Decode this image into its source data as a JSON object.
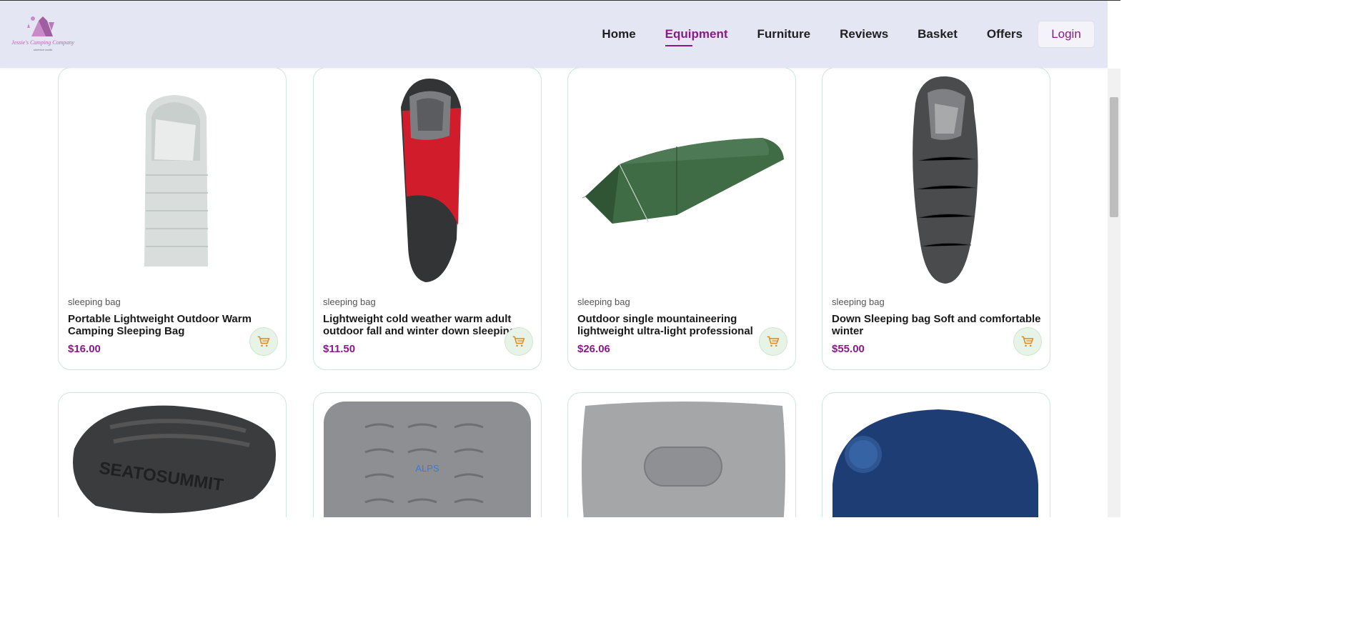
{
  "brand": {
    "logo_text": "Jessie's Camping Company",
    "logo_tagline": "adventure awaits",
    "accent_color": "#8a1a8a"
  },
  "nav": {
    "items": [
      {
        "label": "Home",
        "active": false
      },
      {
        "label": "Equipment",
        "active": true
      },
      {
        "label": "Furniture",
        "active": false
      },
      {
        "label": "Reviews",
        "active": false
      },
      {
        "label": "Basket",
        "active": false
      },
      {
        "label": "Offers",
        "active": false
      }
    ],
    "login_label": "Login"
  },
  "products": [
    {
      "category": "sleeping bag",
      "title": "Portable Lightweight Outdoor Warm Camping Sleeping Bag",
      "price": "$16.00",
      "image": "white-rectangular-sleeping-bag"
    },
    {
      "category": "sleeping bag",
      "title": "Lightweight cold weather warm adult outdoor fall and winter down sleeping bag",
      "price": "$11.50",
      "image": "red-black-mummy-sleeping-bag"
    },
    {
      "category": "sleeping bag",
      "title": "Outdoor single mountaineering lightweight ultra-light professional sleeping bag",
      "price": "$26.06",
      "image": "green-bivy-tent"
    },
    {
      "category": "sleeping bag",
      "title": "Down Sleeping bag Soft and comfortable winter",
      "price": "$55.00",
      "image": "grey-mummy-sleeping-bag"
    }
  ],
  "products_row2": [
    {
      "image": "sea-to-summit-pillow",
      "brand_text": "SEATOSUMMIT"
    },
    {
      "image": "alps-inflatable-pad",
      "brand_text": "ALPS"
    },
    {
      "image": "grey-inflatable-pillow"
    },
    {
      "image": "navy-neck-pillow"
    }
  ]
}
